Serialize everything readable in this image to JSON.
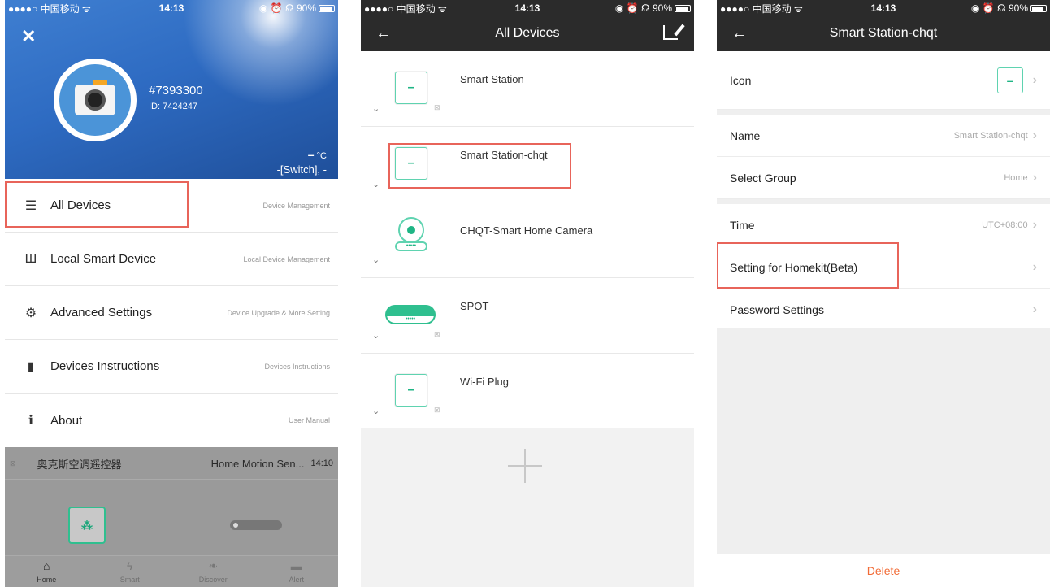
{
  "status": {
    "carrier": "●●●●○ 中国移动 ᯤ",
    "time": "14:13",
    "right": "◉ ⏰ ☊ 90%"
  },
  "screen1": {
    "close_label": "✕",
    "user": {
      "name": "#7393300",
      "id": "ID: 7424247"
    },
    "weather": {
      "temp_value": "–",
      "temp_unit": "°C",
      "switch_text": "-[Switch], -"
    },
    "menu": [
      {
        "icon": "☰",
        "label": "All Devices",
        "sub": "Device Management"
      },
      {
        "icon": "Ш",
        "label": "Local Smart Device",
        "sub": "Local Device Management"
      },
      {
        "icon": "⚙",
        "label": "Advanced Settings",
        "sub": "Device Upgrade & More Setting"
      },
      {
        "icon": "▮",
        "label": "Devices Instructions",
        "sub": "Devices Instructions"
      },
      {
        "icon": "ℹ",
        "label": "About",
        "sub": "User Manual"
      }
    ],
    "bottom": {
      "left_mark": "⊠",
      "left_title": "奥克斯空调遥控器",
      "right_title": "Home Motion Sen...",
      "right_time": "14:10",
      "plug_glyph": "⁂"
    },
    "tabs": [
      {
        "icon": "⌂",
        "label": "Home"
      },
      {
        "icon": "ϟ",
        "label": "Smart"
      },
      {
        "icon": "❧",
        "label": "Discover"
      },
      {
        "icon": "▬",
        "label": "Alert"
      }
    ]
  },
  "screen2": {
    "back": "←",
    "title": "All Devices",
    "devices": [
      {
        "name": "Smart Station",
        "glyph": "–",
        "chevron": "⌄",
        "mark": "⊠"
      },
      {
        "name": "Smart Station-chqt",
        "glyph": "–",
        "chevron": "⌄",
        "mark": ""
      },
      {
        "name": "CHQT-Smart Home Camera",
        "glyph": "•••••",
        "chevron": "⌄",
        "mark": ""
      },
      {
        "name": "SPOT",
        "glyph": "•••••",
        "chevron": "⌄",
        "mark": "⊠"
      },
      {
        "name": "Wi-Fi Plug",
        "glyph": "–",
        "chevron": "⌄",
        "mark": "⊠"
      }
    ]
  },
  "screen3": {
    "back": "←",
    "title": "Smart Station-chqt",
    "rows": {
      "icon": {
        "label": "Icon",
        "glyph": "–"
      },
      "name": {
        "label": "Name",
        "value": "Smart Station-chqt"
      },
      "group": {
        "label": "Select Group",
        "value": "Home"
      },
      "time": {
        "label": "Time",
        "value": "UTC+08:00"
      },
      "homekit": {
        "label": "Setting for Homekit(Beta)"
      },
      "password": {
        "label": "Password Settings"
      }
    },
    "chevron": "›",
    "delete_label": "Delete"
  },
  "colors": {
    "accent_green": "#2fbf8f",
    "highlight_red": "#e8645a",
    "delete_orange": "#f26b36",
    "navbar": "#2b2b2b"
  }
}
